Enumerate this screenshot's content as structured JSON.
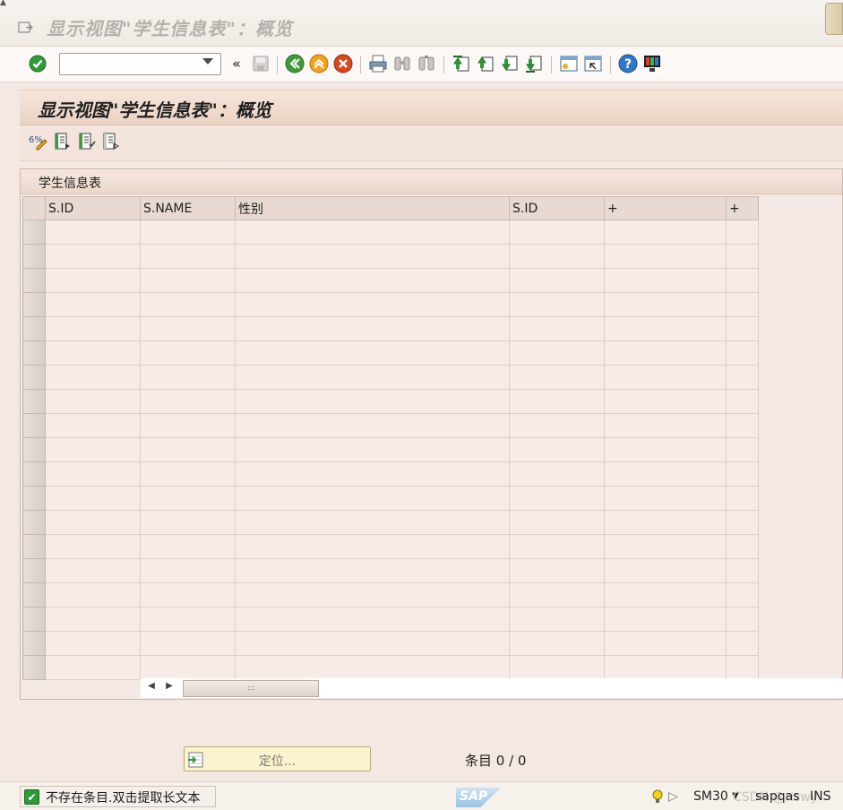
{
  "window": {
    "title": "显示视图\"学生信息表\"：概览"
  },
  "toolbar": {
    "command_value": "",
    "back_label": "«",
    "icons": [
      "enter-icon",
      "save-icon",
      "back-icon",
      "exit-icon",
      "cancel-icon",
      "print-icon",
      "find-icon",
      "find-next-icon",
      "first-page-icon",
      "prev-page-icon",
      "next-page-icon",
      "last-page-icon",
      "new-session-icon",
      "shortcut-icon",
      "help-icon",
      "layout-icon"
    ]
  },
  "screen": {
    "title": "显示视图\"学生信息表\"：概览"
  },
  "table": {
    "title": "学生信息表",
    "columns": [
      "S.ID",
      "S.NAME",
      "性别",
      "S.ID",
      "+",
      "+"
    ],
    "row_count": 19
  },
  "footer": {
    "locate_label": "定位...",
    "entries_label": "条目 0 / 0"
  },
  "status": {
    "message": "不存在条目.双击提取长文本",
    "sap_logo": "SAP",
    "transaction": "SM30",
    "server": "sapqas",
    "mode": "INS",
    "watermark": "CSDN @riswy"
  },
  "colors": {
    "accent_green": "#2f9a39",
    "background": "#f4e9e2",
    "title_band": "#ead2c3"
  }
}
